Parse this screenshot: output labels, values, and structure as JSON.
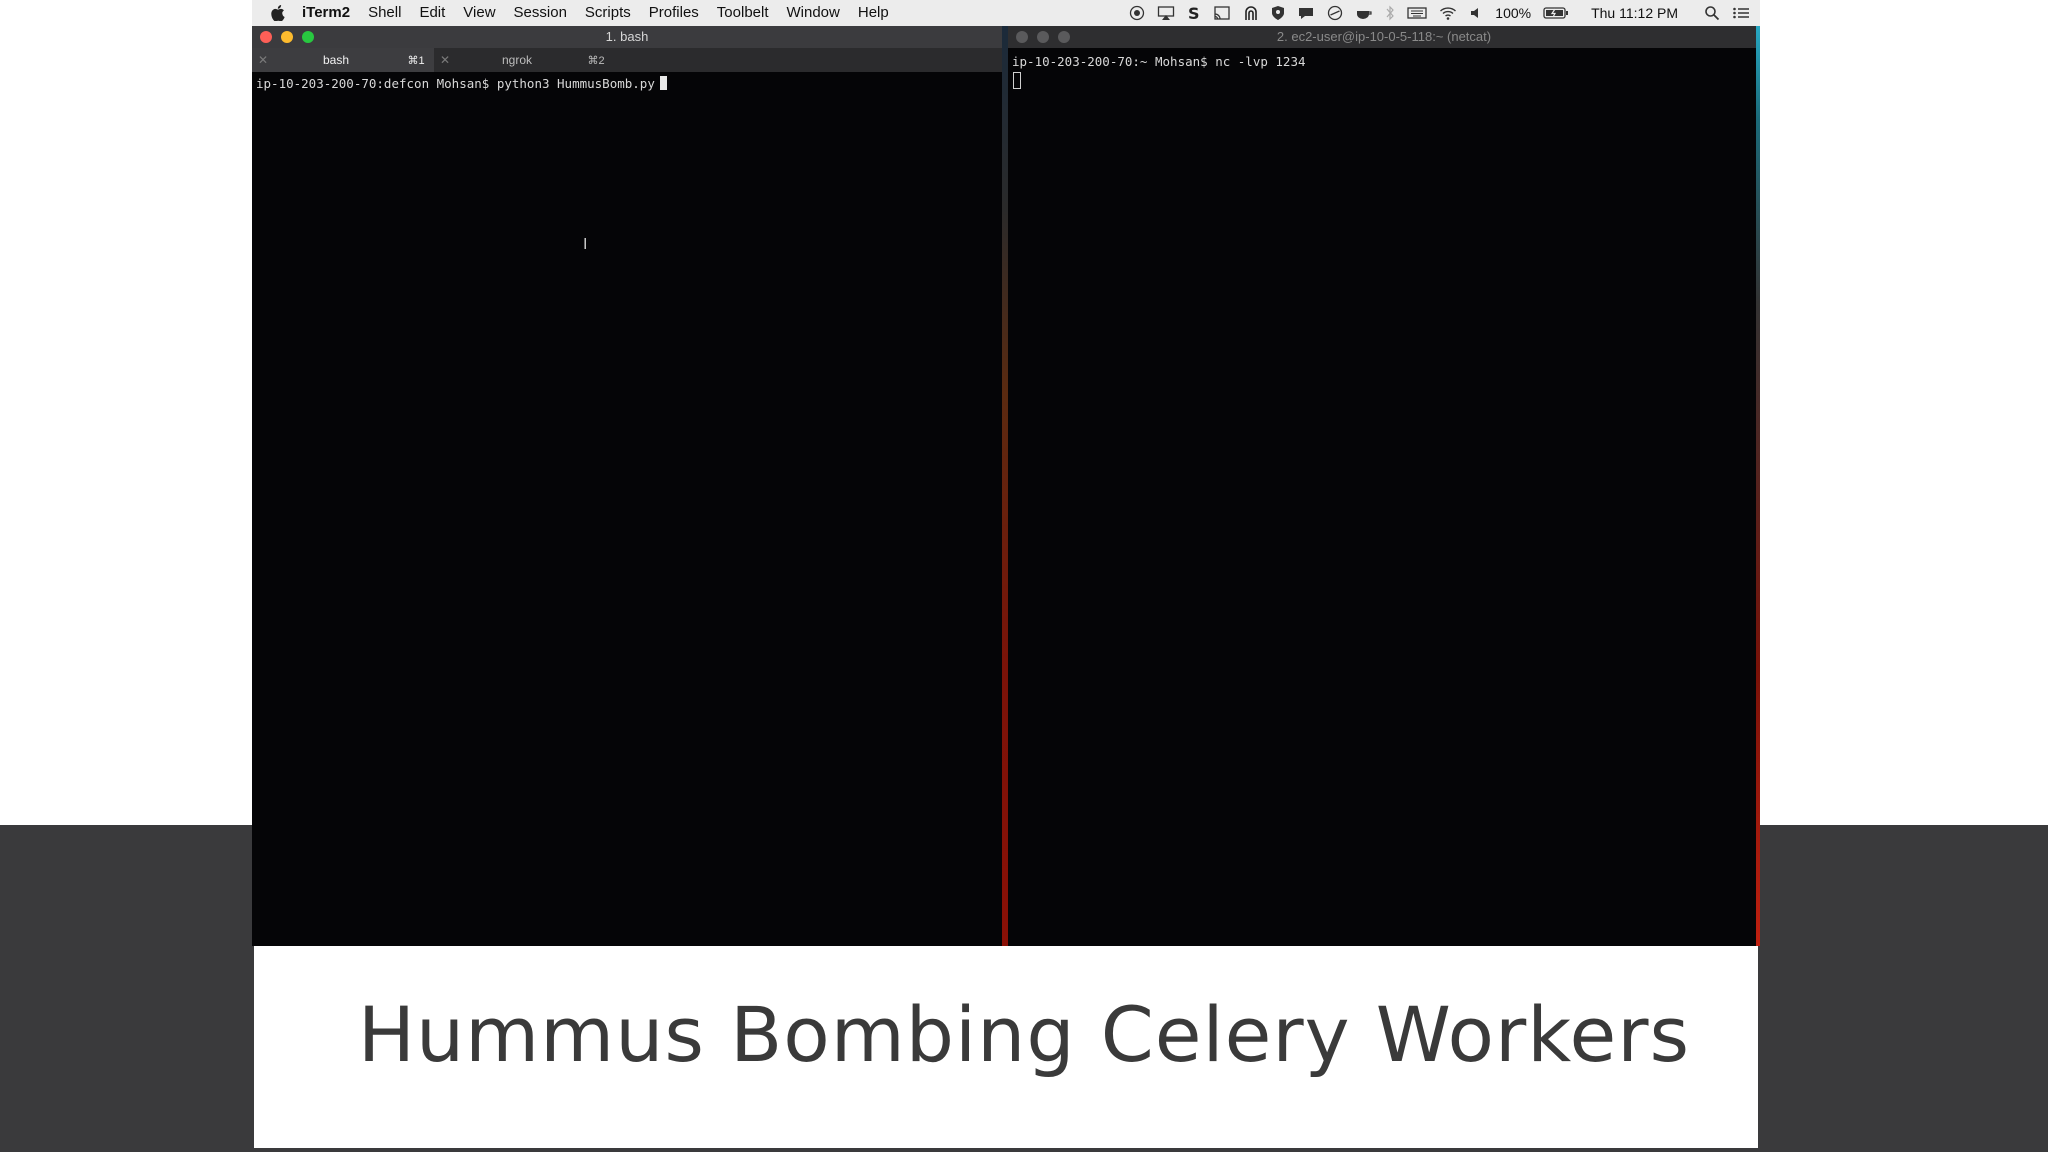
{
  "menubar": {
    "app_name": "iTerm2",
    "menus": [
      "Shell",
      "Edit",
      "View",
      "Session",
      "Scripts",
      "Profiles",
      "Toolbelt",
      "Window",
      "Help"
    ],
    "battery": "100%",
    "clock": "Thu 11:12 PM",
    "icons": [
      "record-icon",
      "airplay-icon",
      "s-app-icon",
      "cast-icon",
      "alfred-icon",
      "shield-icon",
      "notification-icon",
      "circle-icon",
      "cup-icon",
      "bluetooth-icon",
      "keyboard-icon",
      "wifi-icon",
      "volume-icon",
      "battery-icon",
      "search-icon",
      "list-icon"
    ]
  },
  "left_window": {
    "title": "1. bash",
    "tabs": [
      {
        "label": "bash",
        "shortcut": "⌘1",
        "active": true
      },
      {
        "label": "ngrok",
        "shortcut": "⌘2",
        "active": false
      }
    ],
    "command_line": "ip-10-203-200-70:defcon Mohsan$ python3 HummusBomb.py"
  },
  "right_window": {
    "title": "2. ec2-user@ip-10-0-5-118:~ (netcat)",
    "command_line": "ip-10-203-200-70:~ Mohsan$ nc -lvp 1234"
  },
  "caption": "Hummus Bombing Celery Workers",
  "colors": {
    "close": "#fd5f57",
    "minimize": "#fdbb2e",
    "maximize": "#28c840",
    "terminal_bg": "#050507",
    "band": "#3a3a3c"
  }
}
